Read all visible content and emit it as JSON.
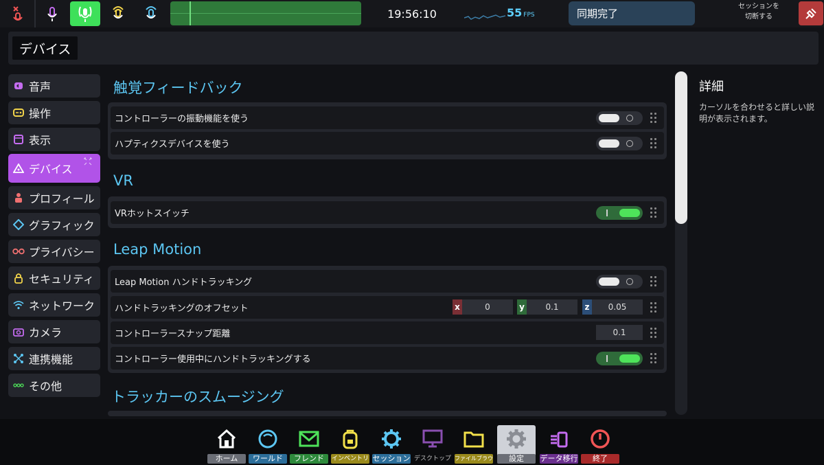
{
  "topbar": {
    "time": "19:56:10",
    "fps_value": "55",
    "fps_unit": "FPS",
    "sync_status": "同期完了",
    "disconnect_label_line1": "セッションを",
    "disconnect_label_line2": "切断する"
  },
  "header": {
    "title": "デバイス"
  },
  "sidebar": {
    "items": [
      {
        "label": "音声",
        "icon": "speaker-icon",
        "color": "#c46cf0"
      },
      {
        "label": "操作",
        "icon": "gamepad-icon",
        "color": "#f2d44a"
      },
      {
        "label": "表示",
        "icon": "window-icon",
        "color": "#c46cf0"
      },
      {
        "label": "デバイス",
        "icon": "device-icon",
        "color": "#ffffff"
      },
      {
        "label": "プロフィール",
        "icon": "person-icon",
        "color": "#f07070"
      },
      {
        "label": "グラフィック",
        "icon": "diamond-icon",
        "color": "#5cc6f2"
      },
      {
        "label": "プライバシー",
        "icon": "glasses-icon",
        "color": "#f07070"
      },
      {
        "label": "セキュリティ",
        "icon": "lock-icon",
        "color": "#f2d44a"
      },
      {
        "label": "ネットワーク",
        "icon": "wifi-icon",
        "color": "#5cc6f2"
      },
      {
        "label": "カメラ",
        "icon": "camera-icon",
        "color": "#c46cf0"
      },
      {
        "label": "連携機能",
        "icon": "integration-icon",
        "color": "#5cc6f2"
      },
      {
        "label": "その他",
        "icon": "more-icon",
        "color": "#4ee35a"
      }
    ]
  },
  "sections": {
    "haptics": {
      "title": "触覚フィードバック",
      "rows": [
        {
          "label": "コントローラーの振動機能を使う",
          "toggle": false
        },
        {
          "label": "ハプティクスデバイスを使う",
          "toggle": false
        }
      ]
    },
    "vr": {
      "title": "VR",
      "rows": [
        {
          "label": "VRホットスイッチ",
          "toggle": true
        }
      ]
    },
    "leap": {
      "title": "Leap Motion",
      "rows": [
        {
          "label": "Leap Motion ハンドトラッキング",
          "toggle": false
        },
        {
          "label": "ハンドトラッキングのオフセット",
          "x_label": "x",
          "x": "0",
          "y_label": "y",
          "y": "0.1",
          "z_label": "z",
          "z": "0.05"
        },
        {
          "label": "コントローラースナップ距離",
          "value": "0.1"
        },
        {
          "label": "コントローラー使用中にハンドトラッキングする",
          "toggle": true
        }
      ]
    },
    "tracker": {
      "title": "トラッカーのスムージング"
    }
  },
  "details": {
    "title": "詳細",
    "text": "カーソルを合わせると詳しい説明が表示されます。"
  },
  "dock": {
    "items": [
      {
        "label": "ホーム",
        "icon": "home-icon",
        "color": "#ffffff",
        "label_bg": "#6b6e76"
      },
      {
        "label": "ワールド",
        "icon": "world-icon",
        "color": "#5cc6f2",
        "label_bg": "#2c6e9a"
      },
      {
        "label": "フレンド",
        "icon": "mail-icon",
        "color": "#4ee35a",
        "label_bg": "#2e8a3c"
      },
      {
        "label": "インベントリ",
        "icon": "backpack-icon",
        "color": "#f2e04a",
        "label_bg": "#9a8a1c"
      },
      {
        "label": "セッション",
        "icon": "gear-session-icon",
        "color": "#5cc6f2",
        "label_bg": "#2c6e9a"
      },
      {
        "label": "デスクトップ",
        "icon": "monitor-icon",
        "color": "#8a4fb0",
        "label_bg": "transparent"
      },
      {
        "label": "ファイルブラウザ",
        "icon": "folder-icon",
        "color": "#f2e04a",
        "label_bg": "#9a8a1c"
      },
      {
        "label": "設定",
        "icon": "settings-icon",
        "color": "#ffffff",
        "label_bg": "#6b6e76"
      },
      {
        "label": "データ移行",
        "icon": "transfer-icon",
        "color": "#c46cf0",
        "label_bg": "#6a2f8e"
      },
      {
        "label": "終了",
        "icon": "power-icon",
        "color": "#f05555",
        "label_bg": "#a82a2a"
      }
    ]
  }
}
